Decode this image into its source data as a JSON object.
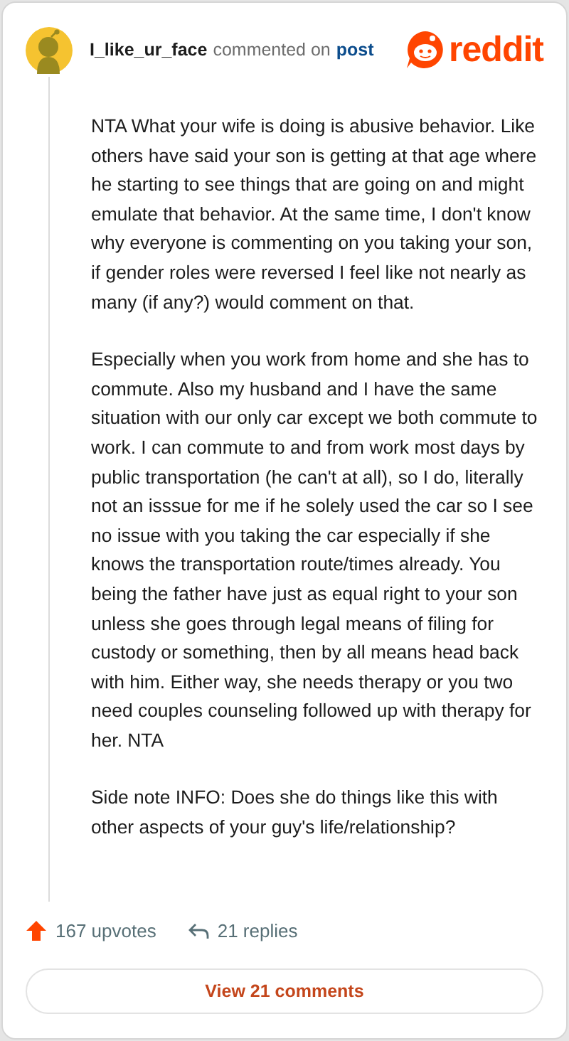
{
  "comment": {
    "author": "I_like_ur_face",
    "action": "commented on",
    "target": "post"
  },
  "logo": {
    "wordmark": "reddit"
  },
  "paragraphs": [
    "NTA What your wife is doing is abusive behavior. Like others have said your son is getting at that age where he starting to see things that are going on and might emulate that behavior. At the same time, I don't know why everyone is commenting on you taking your son, if gender roles were reversed I feel like not nearly as many (if any?) would comment on that.",
    "Especially when you work from home and she has to commute. Also my husband and I have the same situation with our only car except we both commute to work. I can commute to and from work most days by public transportation (he can't at all), so I do, literally not an isssue for me if he solely used the car so I see no issue with you taking the car especially if she knows the transportation route/times already. You being the father have just as equal right to your son unless she goes through legal means of filing for custody or something, then by all means head back with him. Either way, she needs therapy or you two need couples counseling followed up with therapy for her. NTA",
    "Side note INFO: Does she do things like this with other aspects of your guy's life/relationship?"
  ],
  "footer": {
    "upvotes": "167 upvotes",
    "replies": "21 replies"
  },
  "button": {
    "label": "View 21 comments"
  }
}
